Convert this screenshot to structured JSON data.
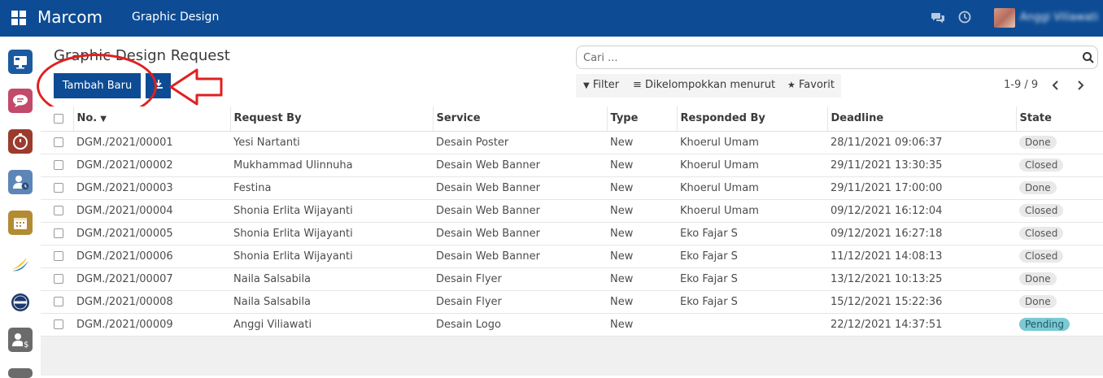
{
  "navbar": {
    "brand": "Marcom",
    "menu_item": "Graphic Design",
    "username": "Anggi Viliawati",
    "color": "#0d4c94"
  },
  "sidebar": {
    "icons": [
      "desktop-app-icon",
      "chat-app-icon",
      "timer-app-icon",
      "user-clock-app-icon",
      "calendar-app-icon",
      "swoosh-logo-app-icon",
      "badge-logo-app-icon",
      "user-dollar-app-icon"
    ]
  },
  "control_panel": {
    "title": "Graphic Design Request",
    "create_label": "Tambah Baru",
    "search_placeholder": "Cari ...",
    "filter_label": "Filter",
    "group_by_label": "Dikelompokkan menurut",
    "favorites_label": "Favorit",
    "pager": "1-9 / 9"
  },
  "table": {
    "columns": [
      "No.",
      "Request By",
      "Service",
      "Type",
      "Responded By",
      "Deadline",
      "State"
    ],
    "rows": [
      {
        "no": "DGM./2021/00001",
        "request_by": "Yesi Nartanti",
        "service": "Desain Poster",
        "type": "New",
        "responded_by": "Khoerul Umam",
        "deadline": "28/11/2021 09:06:37",
        "state": "Done"
      },
      {
        "no": "DGM./2021/00002",
        "request_by": "Mukhammad Ulinnuha",
        "service": "Desain Web Banner",
        "type": "New",
        "responded_by": "Khoerul Umam",
        "deadline": "29/11/2021 13:30:35",
        "state": "Closed"
      },
      {
        "no": "DGM./2021/00003",
        "request_by": "Festina",
        "service": "Desain Web Banner",
        "type": "New",
        "responded_by": "Khoerul Umam",
        "deadline": "29/11/2021 17:00:00",
        "state": "Done"
      },
      {
        "no": "DGM./2021/00004",
        "request_by": "Shonia Erlita Wijayanti",
        "service": "Desain Web Banner",
        "type": "New",
        "responded_by": "Khoerul Umam",
        "deadline": "09/12/2021 16:12:04",
        "state": "Closed"
      },
      {
        "no": "DGM./2021/00005",
        "request_by": "Shonia Erlita Wijayanti",
        "service": "Desain Web Banner",
        "type": "New",
        "responded_by": "Eko Fajar S",
        "deadline": "09/12/2021 16:27:18",
        "state": "Closed"
      },
      {
        "no": "DGM./2021/00006",
        "request_by": "Shonia Erlita Wijayanti",
        "service": "Desain Web Banner",
        "type": "New",
        "responded_by": "Eko Fajar S",
        "deadline": "11/12/2021 14:08:13",
        "state": "Closed"
      },
      {
        "no": "DGM./2021/00007",
        "request_by": "Naila Salsabila",
        "service": "Desain Flyer",
        "type": "New",
        "responded_by": "Eko Fajar S",
        "deadline": "13/12/2021 10:13:25",
        "state": "Done"
      },
      {
        "no": "DGM./2021/00008",
        "request_by": "Naila Salsabila",
        "service": "Desain Flyer",
        "type": "New",
        "responded_by": "Eko Fajar S",
        "deadline": "15/12/2021 15:22:36",
        "state": "Done"
      },
      {
        "no": "DGM./2021/00009",
        "request_by": "Anggi Viliawati",
        "service": "Desain Logo",
        "type": "New",
        "responded_by": "",
        "deadline": "22/12/2021 14:37:51",
        "state": "Pending"
      }
    ]
  }
}
